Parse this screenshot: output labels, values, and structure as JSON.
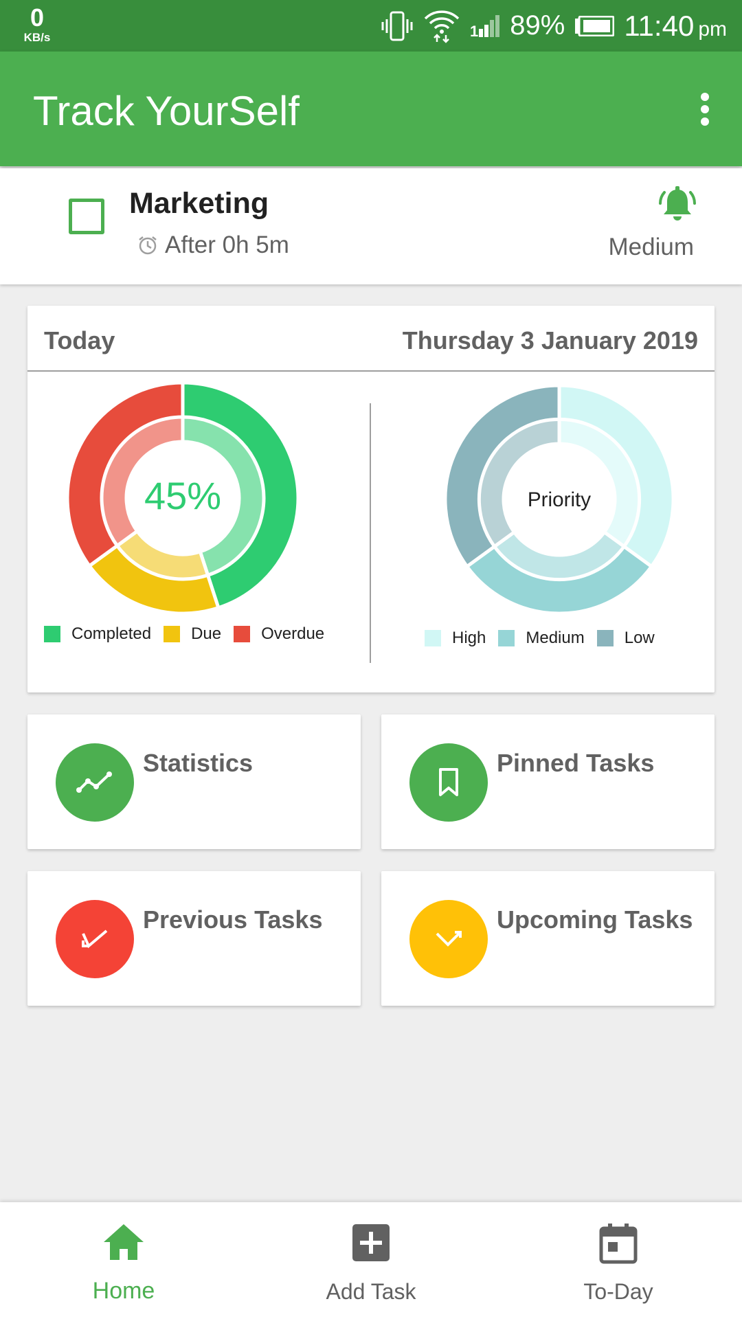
{
  "status_bar": {
    "net_speed": "0",
    "net_unit": "KB/s",
    "battery": "89%",
    "time": "11:40",
    "ampm": "pm"
  },
  "app_bar": {
    "title": "Track YourSelf"
  },
  "task": {
    "title": "Marketing",
    "time": "After 0h 5m",
    "priority": "Medium"
  },
  "today": {
    "label": "Today",
    "date": "Thursday 3 January 2019"
  },
  "chart_data": [
    {
      "type": "pie",
      "title": "",
      "center_label": "45%",
      "categories": [
        "Completed",
        "Due",
        "Overdue"
      ],
      "values": [
        45,
        20,
        35
      ],
      "colors": [
        "#2ecc71",
        "#f1c40f",
        "#e74c3c"
      ],
      "inner_colors": [
        "#86e2ad",
        "#f6dc76",
        "#f1948a"
      ],
      "legend": "bottom"
    },
    {
      "type": "pie",
      "title": "",
      "center_label": "Priority",
      "categories": [
        "High",
        "Medium",
        "Low"
      ],
      "values": [
        35,
        30,
        35
      ],
      "colors": [
        "#d1f7f5",
        "#96d5d6",
        "#8ab4bc"
      ],
      "inner_colors": [
        "#e4fbfa",
        "#c0e6e7",
        "#b9d2d6"
      ],
      "legend": "bottom"
    }
  ],
  "tiles": [
    {
      "label": "Statistics",
      "icon": "trending-icon",
      "color": "#4caf50"
    },
    {
      "label": "Pinned Tasks",
      "icon": "bookmark-icon",
      "color": "#4caf50"
    },
    {
      "label": "Previous Tasks",
      "icon": "call-received-icon",
      "color": "#f44336"
    },
    {
      "label": "Upcoming Tasks",
      "icon": "call-missed-icon",
      "color": "#ffc107"
    }
  ],
  "nav": {
    "home": "Home",
    "add": "Add Task",
    "today": "To-Day"
  },
  "colors": {
    "primary": "#4caf50",
    "primary_dark": "#388e3c"
  }
}
